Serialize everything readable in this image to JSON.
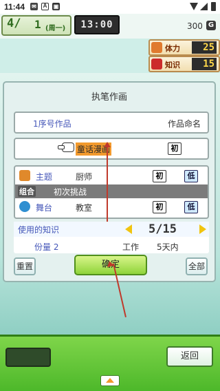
{
  "status_bar": {
    "time": "11:44",
    "icons": [
      "notification-icon",
      "a-icon",
      "tray-icon",
      "wifi-icon",
      "signal-icon",
      "battery-icon"
    ]
  },
  "hud": {
    "week": "4",
    "week_suffix": "/",
    "day": "1",
    "weekday": "(周一)",
    "clock": "13:00",
    "money": "300",
    "currency_symbol": "G"
  },
  "stats": [
    {
      "label": "体力",
      "value": "25",
      "icon": "stamina-icon",
      "icon_color": "#e07a2e"
    },
    {
      "label": "知识",
      "value": "15",
      "icon": "book-icon",
      "icon_color": "#cc2b2b"
    }
  ],
  "panel": {
    "title": "执笔作画",
    "work_number": "1序号作品",
    "name_work": "作品命名",
    "genre": "童话漫画",
    "genre_badge": "初",
    "theme_label": "主题",
    "theme_value": "厨师",
    "theme_badge_1": "初",
    "theme_badge_2": "低",
    "combo_tag": "组合",
    "combo_value": "初次挑战",
    "stage_label": "舞台",
    "stage_value": "教室",
    "stage_badge_1": "初",
    "stage_badge_2": "低",
    "knowledge_label": "使用的知识",
    "knowledge_count": "5/15",
    "amount_label": "份量 2",
    "work_label": "工作",
    "work_days": "5天内",
    "reset_button": "重置",
    "confirm_button": "确定",
    "all_button": "全部"
  },
  "bottom": {
    "back_button": "返回"
  },
  "colors": {
    "accent_orange": "#f29a2e",
    "confirm_green": "#8fd43a",
    "label_blue": "#4456b8",
    "annotation_red": "#c0392b"
  }
}
